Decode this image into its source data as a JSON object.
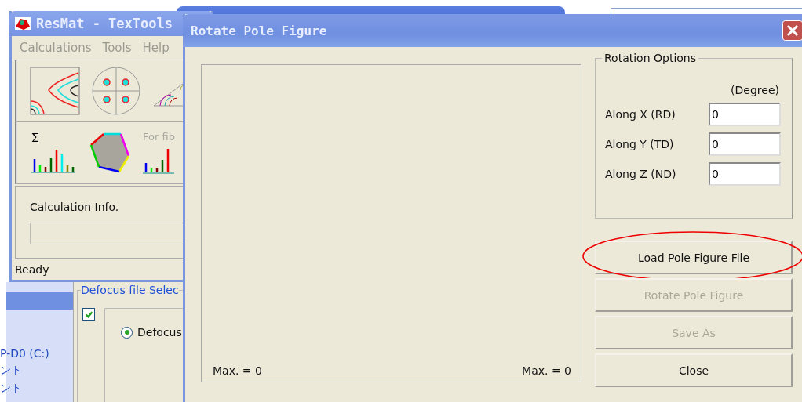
{
  "explorer_window": {
    "drive_label": "P-D0 (C:)",
    "items": [
      "ント",
      "ント"
    ]
  },
  "back_dialog": {
    "group_label": "Defocus file Selec",
    "checkbox": {
      "checked": true
    },
    "radio": {
      "label": "Defocus",
      "selected": true
    }
  },
  "main_window": {
    "title": "ResMat - TexTools",
    "menu": [
      {
        "label": "Calculations"
      },
      {
        "label": "Tools"
      },
      {
        "label": "Help"
      }
    ],
    "sum_symbol": "Σ",
    "fiber_label": "For fib",
    "calc_info_label": "Calculation Info.",
    "status_bar": "Ready"
  },
  "dialog": {
    "title": "Rotate Pole Figure",
    "plot": {
      "max_left": "Max. = 0",
      "max_right": "Max. = 0"
    },
    "rotation_options": {
      "title": "Rotation Options",
      "unit": "(Degree)",
      "fields": [
        {
          "label": "Along X (RD)",
          "value": "0"
        },
        {
          "label": "Along Y (TD)",
          "value": "0"
        },
        {
          "label": "Along Z (ND)",
          "value": "0"
        }
      ]
    },
    "buttons": [
      {
        "label": "Load Pole Figure File",
        "disabled": false,
        "circled": true
      },
      {
        "label": "Rotate Pole Figure",
        "disabled": true,
        "circled": false
      },
      {
        "label": "Save As",
        "disabled": true,
        "circled": false
      },
      {
        "label": "Close",
        "disabled": false,
        "circled": false
      }
    ]
  }
}
